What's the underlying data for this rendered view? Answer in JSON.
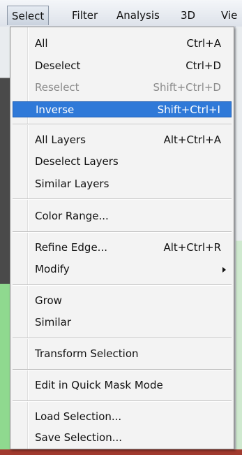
{
  "menubar": {
    "items": [
      "Select",
      "Filter",
      "Analysis",
      "3D",
      "Vie"
    ]
  },
  "select_menu": {
    "items": [
      {
        "label": "All",
        "shortcut": "Ctrl+A"
      },
      {
        "label": "Deselect",
        "shortcut": "Ctrl+D"
      },
      {
        "label": "Reselect",
        "shortcut": "Shift+Ctrl+D",
        "state": "disabled"
      },
      {
        "label": "Inverse",
        "shortcut": "Shift+Ctrl+I",
        "state": "highlighted"
      },
      {
        "label": "All Layers",
        "shortcut": "Alt+Ctrl+A"
      },
      {
        "label": "Deselect Layers",
        "shortcut": ""
      },
      {
        "label": "Similar Layers",
        "shortcut": ""
      },
      {
        "label": "Color Range...",
        "shortcut": ""
      },
      {
        "label": "Refine Edge...",
        "shortcut": "Alt+Ctrl+R"
      },
      {
        "label": "Modify",
        "shortcut": "",
        "submenu_icon": "submenu-arrow-icon"
      },
      {
        "label": "Grow",
        "shortcut": ""
      },
      {
        "label": "Similar",
        "shortcut": ""
      },
      {
        "label": "Transform Selection",
        "shortcut": ""
      },
      {
        "label": "Edit in Quick Mask Mode",
        "shortcut": ""
      },
      {
        "label": "Load Selection...",
        "shortcut": ""
      },
      {
        "label": "Save Selection...",
        "shortcut": ""
      }
    ]
  },
  "colors": {
    "highlight": "#2f79d8",
    "menu_background": "#f3f3f3",
    "disabled_text": "#8b8b8b"
  }
}
